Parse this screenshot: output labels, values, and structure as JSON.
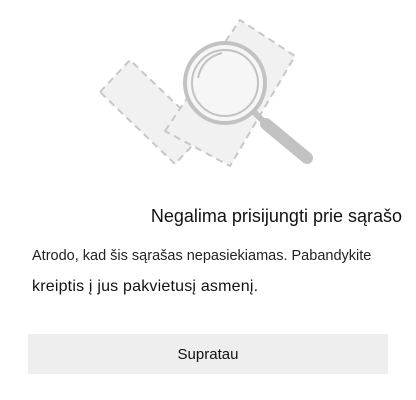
{
  "dialog": {
    "illustration_icon": "search-magnifier-illustration",
    "title": "Negalima prisijungti prie sąrašo",
    "message_line1": "Atrodo, kad šis sąrašas nepasiekiamas. Pabandykite",
    "message_line2": "kreiptis į jus pakvietusį asmenį.",
    "button_label": "Supratau"
  },
  "colors": {
    "illustration_stroke": "#c7c7c7",
    "illustration_fill": "#f1f1f1",
    "button_bg": "#eeeeee",
    "background": "#ffffff"
  }
}
